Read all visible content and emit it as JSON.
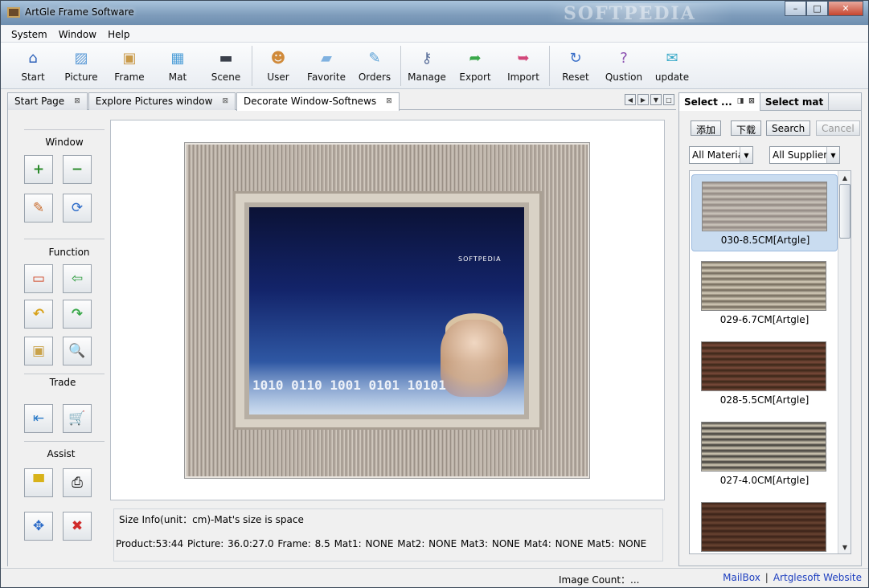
{
  "window": {
    "title": "ArtGle Frame Software",
    "watermark": "SOFTPEDIA",
    "min": "–",
    "max": "□",
    "close": "✕"
  },
  "menu": [
    "System",
    "Window",
    "Help"
  ],
  "toolbar": [
    {
      "label": "Start",
      "icon": "home-icon",
      "color": "#2a5fb8"
    },
    {
      "label": "Picture",
      "icon": "picture-icon",
      "color": "#5b9ad6"
    },
    {
      "label": "Frame",
      "icon": "frame-icon",
      "color": "#c99a4a"
    },
    {
      "label": "Mat",
      "icon": "mat-icon",
      "color": "#4f9fd8"
    },
    {
      "label": "Scene",
      "icon": "scene-icon",
      "color": "#3a3f4a"
    },
    {
      "label": "User",
      "icon": "users-icon",
      "color": "#d08a3a"
    },
    {
      "label": "Favorite",
      "icon": "folder-icon",
      "color": "#7fb1e0"
    },
    {
      "label": "Orders",
      "icon": "orders-icon",
      "color": "#59a0d6"
    },
    {
      "label": "Manage",
      "icon": "key-icon",
      "color": "#5a6f9a"
    },
    {
      "label": "Export",
      "icon": "export-arrow-icon",
      "color": "#3aa84a"
    },
    {
      "label": "Import",
      "icon": "import-arrow-icon",
      "color": "#d2477a"
    },
    {
      "label": "Reset",
      "icon": "reset-icon",
      "color": "#3a6fc8"
    },
    {
      "label": "Qustion",
      "icon": "question-icon",
      "color": "#8a4fb0"
    },
    {
      "label": "update",
      "icon": "update-icon",
      "color": "#39a9c8"
    }
  ],
  "tabs": [
    {
      "label": "Start Page",
      "close": "⊠"
    },
    {
      "label": "Explore Pictures window",
      "close": "⊠"
    },
    {
      "label": "Decorate Window-Softnews",
      "close": "⊠"
    }
  ],
  "tab_controls": [
    "◀",
    "▶",
    "▼",
    "□"
  ],
  "left_sections": {
    "window": "Window",
    "function": "Function",
    "trade": "Trade",
    "assist": "Assist"
  },
  "left_buttons": {
    "zoom_in": "+",
    "zoom_out": "−",
    "edit": "✎",
    "refresh": "⟳",
    "crop": "▭",
    "back": "⇦",
    "undo": "↶",
    "redo": "↷",
    "image": "▣",
    "preview": "🔍",
    "exit": "⇤",
    "cart": "🛒",
    "display": "▀",
    "print": "⎙",
    "fullscreen": "✥",
    "delete": "✖"
  },
  "canvas": {
    "image_brand": "SOFTPEDIA",
    "image_digits": "1010 0110 1001 0101 10101"
  },
  "size_info": {
    "legend": "Size Info(unit：cm)-Mat's size is space",
    "values": "Product:53:44   Picture:  36.0:27.0  Frame:  8.5  Mat1:  NONE  Mat2:  NONE  Mat3:  NONE  Mat4:  NONE  Mat5:  NONE"
  },
  "right_panel": {
    "tabs": [
      {
        "label": "Select ...",
        "pin": "◨",
        "close": "⊠"
      },
      {
        "label": "Select mat"
      }
    ],
    "buttons": {
      "add": "添加",
      "download": "下载",
      "search": "Search",
      "cancel": "Cancel"
    },
    "material": "All Material",
    "supplier": "All Supplier",
    "frames": [
      {
        "caption": "030-8.5CM[Artgle]",
        "c1": "#8f8680",
        "c2": "#cfc8bf",
        "selected": true
      },
      {
        "caption": "029-6.7CM[Artgle]",
        "c1": "#6f6658",
        "c2": "#d8d0bd",
        "selected": false
      },
      {
        "caption": "028-5.5CM[Artgle]",
        "c1": "#3a2618",
        "c2": "#7a4a3a",
        "selected": false
      },
      {
        "caption": "027-4.0CM[Artgle]",
        "c1": "#3c3a36",
        "c2": "#d6cdb8",
        "selected": false
      },
      {
        "caption": "",
        "c1": "#3a2218",
        "c2": "#6a4432",
        "selected": false
      }
    ],
    "scroll_up": "▲",
    "scroll_down": "▼"
  },
  "status": {
    "image_count": "Image Count：...",
    "mailbox": "MailBox",
    "separator": "|",
    "website": "Artglesoft Website"
  }
}
